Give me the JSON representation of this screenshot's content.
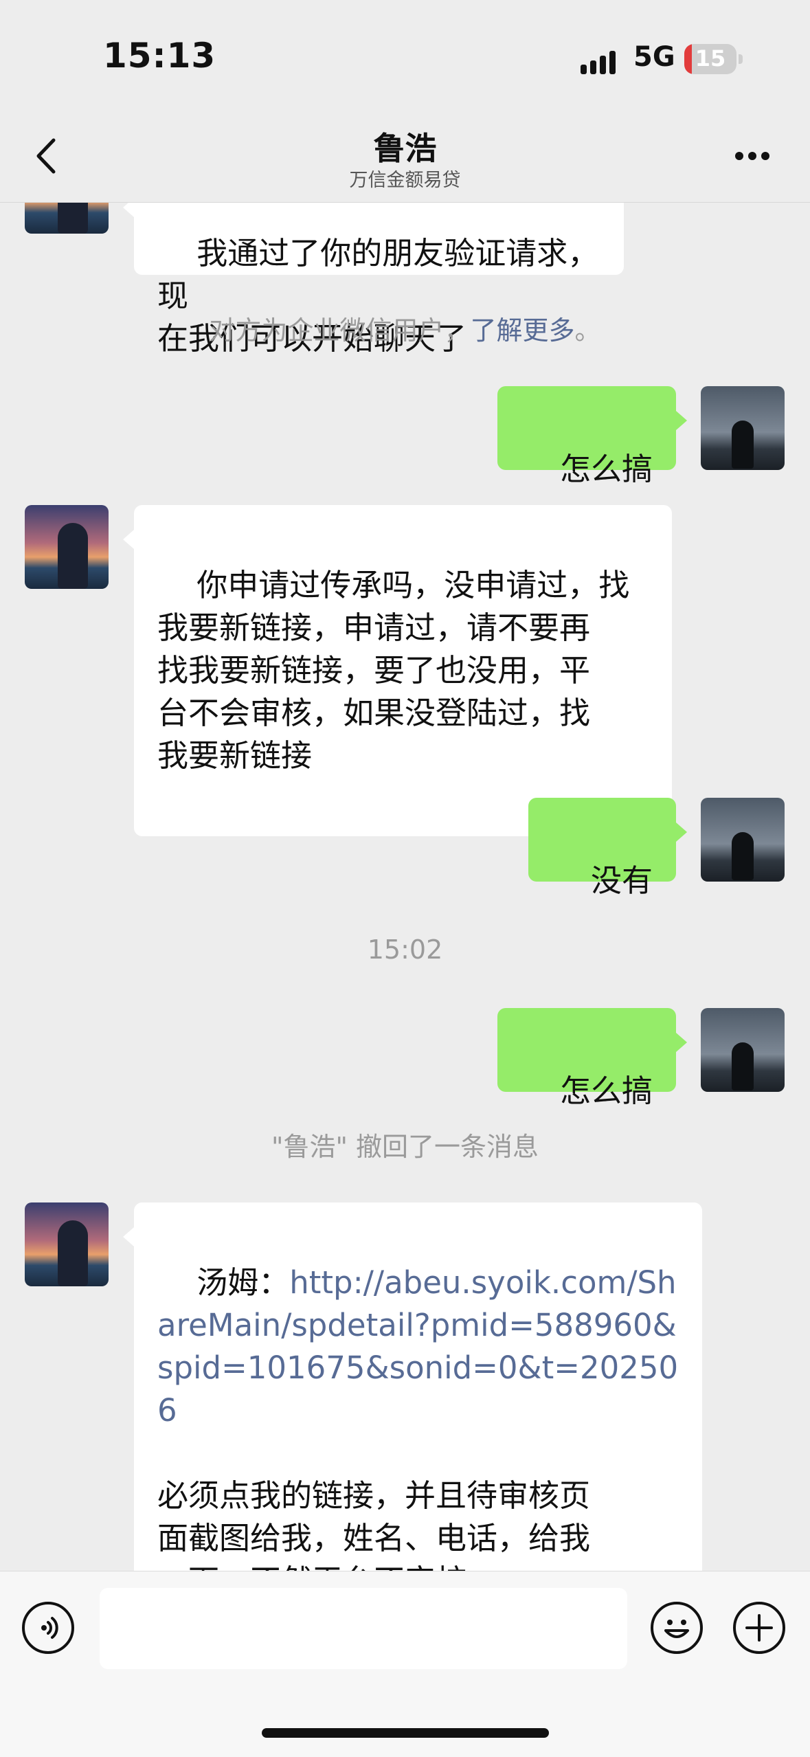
{
  "status_bar": {
    "time": "15:13",
    "network": "5G",
    "battery": "15",
    "battery_level": 0.15
  },
  "header": {
    "title": "鲁浩",
    "subtitle": "万信金额易贷",
    "back_icon": "chevron-left-icon",
    "more_icon": "more-dots-icon"
  },
  "messages": [
    {
      "from": "other",
      "text": "我通过了你的朋友验证请求，现\n在我们可以开始聊天了"
    },
    {
      "system_text": "对方为企业微信用户，",
      "system_link": "了解更多",
      "system_end": "。"
    },
    {
      "from": "self",
      "text": "怎么搞"
    },
    {
      "from": "other",
      "text": "你申请过传承吗，没申请过，找\n我要新链接，申请过，请不要再\n找我要新链接，要了也没用，平\n台不会审核，如果没登陆过，找\n我要新链接"
    },
    {
      "from": "self",
      "text": "没有"
    },
    {
      "timestamp": "15:02"
    },
    {
      "from": "self",
      "text": "怎么搞"
    },
    {
      "system_text": "\"鲁浩\" 撤回了一条消息"
    },
    {
      "from": "other",
      "prefix": "汤姆：",
      "link": "http://abeu.syoik.com/ShareMain/spdetail?pmid=588960&spid=101675&sonid=0&t=202506",
      "text": "\n\n必须点我的链接，并且待审核页\n面截图给我，姓名、电话，给我\n一下，不然平台不审核"
    }
  ],
  "input_bar": {
    "voice_icon": "voice-icon",
    "emoji_icon": "emoji-icon",
    "plus_icon": "plus-icon",
    "placeholder": ""
  }
}
